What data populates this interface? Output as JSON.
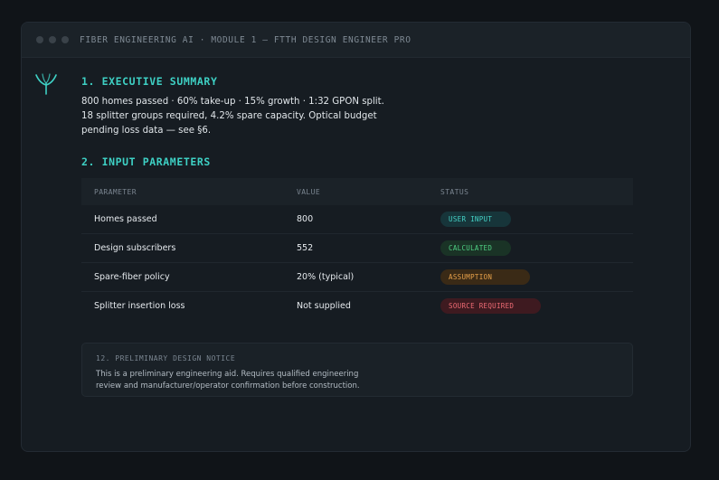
{
  "window": {
    "title": "FIBER ENGINEERING AI · MODULE 1 — FTTH DESIGN ENGINEER PRO"
  },
  "logo_icon": "fiber-split-icon",
  "colors": {
    "accent": "#3ed0c4",
    "user_input": "#45d4c8",
    "calculated": "#4fd083",
    "assumption": "#e7a14a",
    "source_required": "#ef6b74"
  },
  "executive_summary": {
    "heading": "1. EXECUTIVE SUMMARY",
    "lines": [
      "800 homes passed · 60% take-up · 15% growth · 1:32 GPON split.",
      "18 splitter groups required, 4.2% spare capacity. Optical budget",
      "pending loss data — see §6."
    ]
  },
  "input_parameters": {
    "heading": "2. INPUT PARAMETERS",
    "columns": [
      "PARAMETER",
      "VALUE",
      "STATUS"
    ],
    "rows": [
      {
        "parameter": "Homes passed",
        "value": "800",
        "status": "USER INPUT"
      },
      {
        "parameter": "Design subscribers",
        "value": "552",
        "status": "CALCULATED"
      },
      {
        "parameter": "Spare-fiber policy",
        "value": "20% (typical)",
        "status": "ASSUMPTION"
      },
      {
        "parameter": "Splitter insertion loss",
        "value": "Not supplied",
        "status": "SOURCE REQUIRED"
      }
    ]
  },
  "notice": {
    "title": "12. PRELIMINARY DESIGN NOTICE",
    "lines": [
      "This is a preliminary engineering aid. Requires qualified engineering",
      "review and manufacturer/operator confirmation before construction."
    ]
  }
}
